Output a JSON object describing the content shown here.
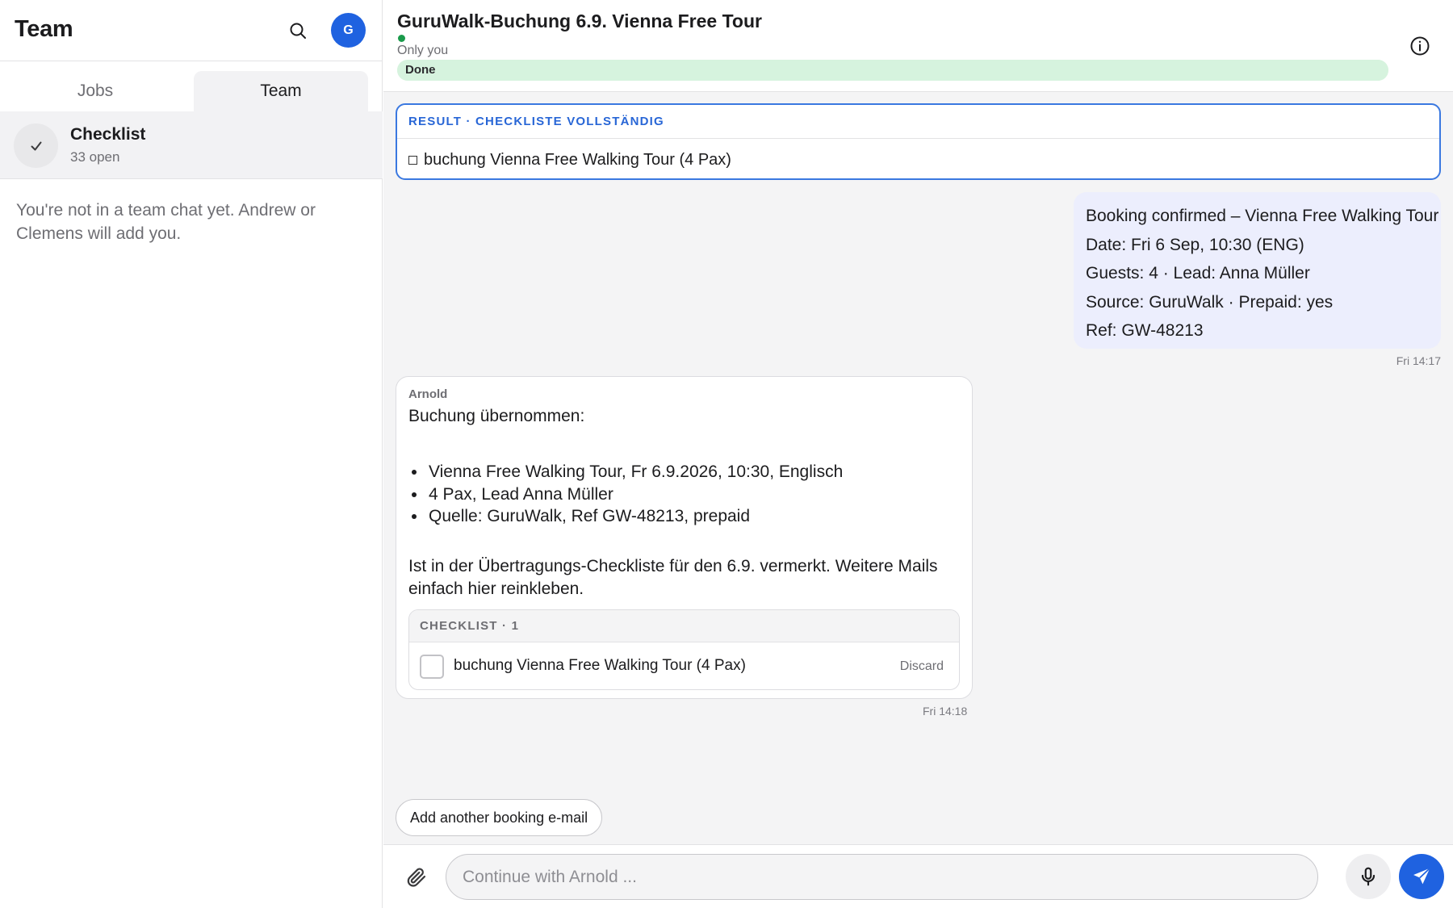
{
  "sidebar": {
    "title": "Team",
    "avatar_initial": "G",
    "tabs": [
      {
        "label": "Jobs"
      },
      {
        "label": "Team"
      }
    ],
    "checklist": {
      "title": "Checklist",
      "subtitle": "33 open"
    },
    "empty_message": "You're not in a team chat yet. Andrew or Clemens will add you."
  },
  "header": {
    "title": "GuruWalk-Buchung 6.9. Vienna Free Tour",
    "visibility": "Only you",
    "status_label": "Done",
    "status_progress": 1.0
  },
  "result_card": {
    "label": "RESULT · CHECKLISTE VOLLSTÄNDIG",
    "item": "buchung Vienna Free Walking Tour (4 Pax)"
  },
  "user_message": {
    "lines": [
      "Booking confirmed – Vienna Free Walking Tour",
      "Date: Fri 6 Sep, 10:30 (ENG)",
      "Guests: 4 · Lead: Anna Müller",
      "Source: GuruWalk · Prepaid: yes",
      "Ref: GW-48213"
    ],
    "timestamp": "Fri 14:17"
  },
  "bot_message": {
    "sender": "Arnold",
    "intro": "Buchung übernommen:",
    "bullets": [
      "Vienna Free Walking Tour, Fr 6.9.2026, 10:30, Englisch",
      "4 Pax, Lead Anna Müller",
      "Quelle: GuruWalk, Ref GW-48213, prepaid"
    ],
    "outro": "Ist in der Übertragungs-Checkliste für den 6.9. vermerkt. Weitere Mails einfach hier reinkleben.",
    "checklist": {
      "label": "CHECKLIST · 1",
      "item": "buchung Vienna Free Walking Tour (4 Pax)",
      "discard_label": "Discard"
    },
    "timestamp": "Fri 14:18"
  },
  "suggestion": "Add another booking e-mail",
  "composer": {
    "placeholder": "Continue with Arnold ..."
  },
  "colors": {
    "accent": "#1f62e0",
    "result_border": "#3a78e0",
    "done_bg": "#e4f7e8",
    "online_dot": "#1a9a4b",
    "user_bubble": "#eceefd"
  }
}
